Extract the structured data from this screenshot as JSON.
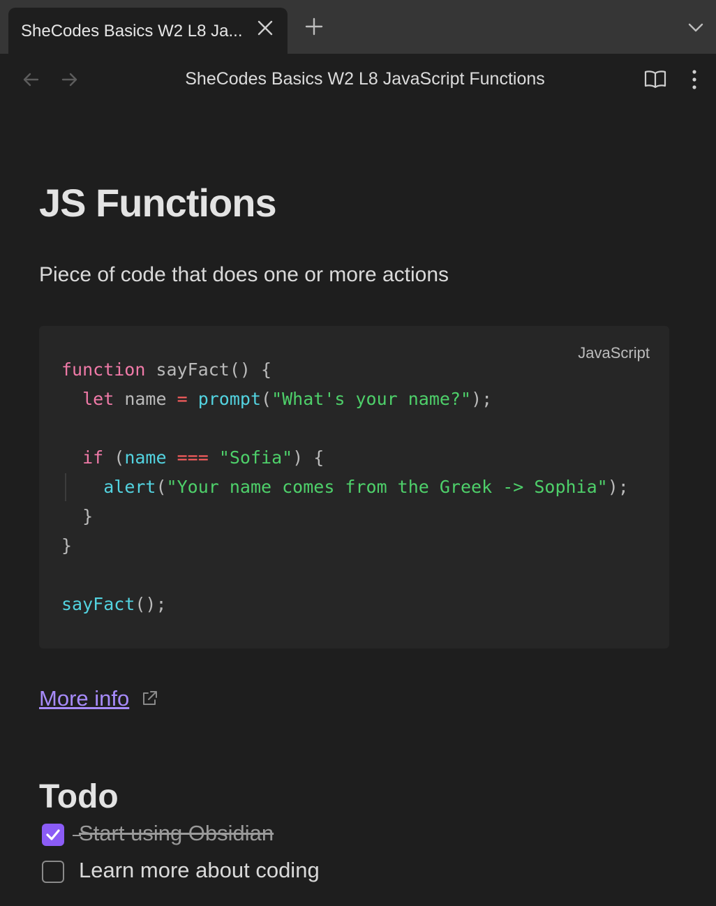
{
  "tabbar": {
    "active_tab_title": "SheCodes Basics W2 L8 Ja..."
  },
  "header": {
    "view_title": "SheCodes Basics W2 L8 JavaScript Functions"
  },
  "note": {
    "heading": "JS Functions",
    "paragraph": "Piece of code that does one or more actions",
    "code_language": "JavaScript",
    "code_tokens": {
      "l1": [
        "function",
        " sayFact() {"
      ],
      "l2": [
        "  ",
        "let",
        " name ",
        "=",
        " ",
        "prompt",
        "(",
        "\"What's your name?\"",
        ");"
      ],
      "l4": [
        "  ",
        "if",
        " (",
        "name",
        " ",
        "===",
        " ",
        "\"Sofia\"",
        ") {"
      ],
      "l5": [
        "    ",
        "alert",
        "(",
        "\"Your name comes from the Greek -> Sophia\"",
        ");"
      ],
      "l6": [
        "  }"
      ],
      "l7": [
        "}"
      ],
      "l9": [
        "sayFact",
        "();"
      ]
    },
    "link_text": "More info",
    "todo_heading": "Todo",
    "todos": [
      {
        "text": "Start using Obsidian",
        "done": true
      },
      {
        "text": "Learn more about coding",
        "done": false
      }
    ]
  },
  "colors": {
    "accent": "#8b5cf6",
    "link": "#a78bfa",
    "keyword": "#f07aa8",
    "function": "#53d3e0",
    "string": "#4ed06a",
    "operator": "#ff5f5f"
  },
  "icons": [
    "close-icon",
    "plus-icon",
    "chevron-down-icon",
    "arrow-left-icon",
    "arrow-right-icon",
    "book-open-icon",
    "more-vertical-icon",
    "external-link-icon",
    "check-icon"
  ]
}
